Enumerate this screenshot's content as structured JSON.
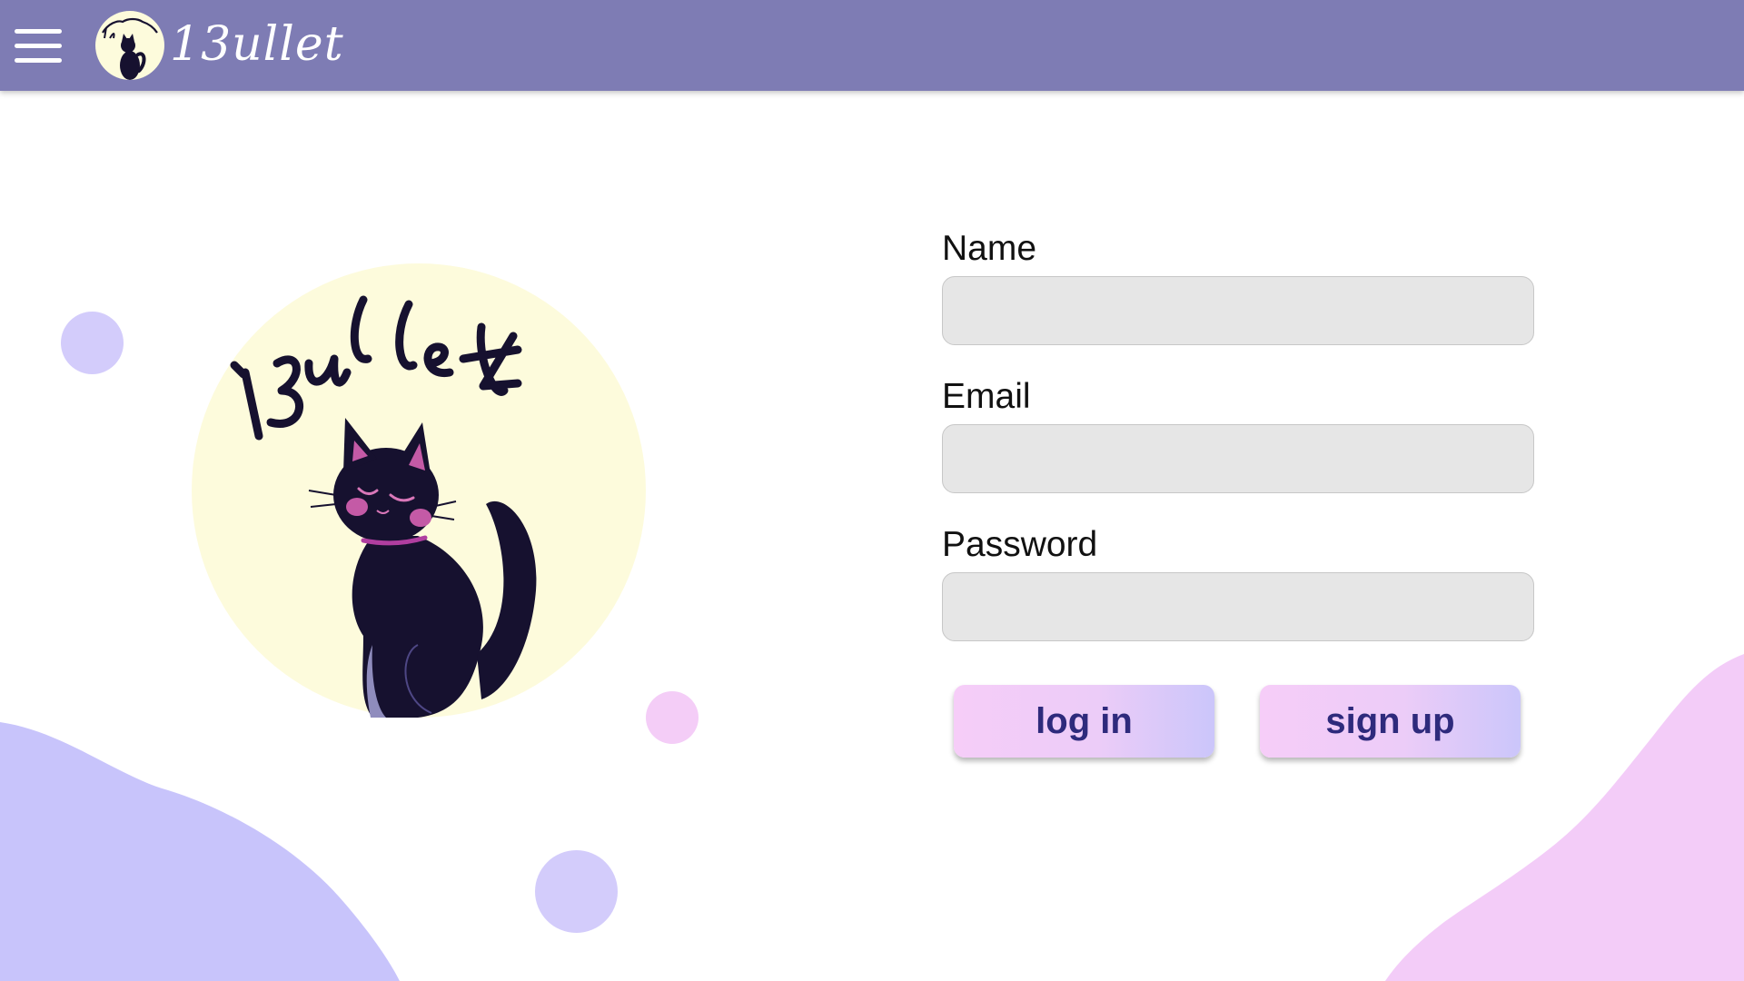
{
  "header": {
    "brand_name": "13ullet",
    "menu_icon": "hamburger-menu-icon",
    "background_color": "#7e7cb4"
  },
  "logo": {
    "text": "13ullet",
    "background_color": "#fdfbdc",
    "cat_color": "#16112f",
    "accent_color": "#b03ea0"
  },
  "form": {
    "name": {
      "label": "Name",
      "value": "",
      "placeholder": ""
    },
    "email": {
      "label": "Email",
      "value": "",
      "placeholder": ""
    },
    "password": {
      "label": "Password",
      "value": "",
      "placeholder": ""
    },
    "login_label": "log in",
    "signup_label": "sign up"
  },
  "colors": {
    "lavender": "#c8c4fb",
    "pink": "#f3ccf8",
    "button_text": "#2e2a7c",
    "input_bg": "#e6e6e6"
  }
}
